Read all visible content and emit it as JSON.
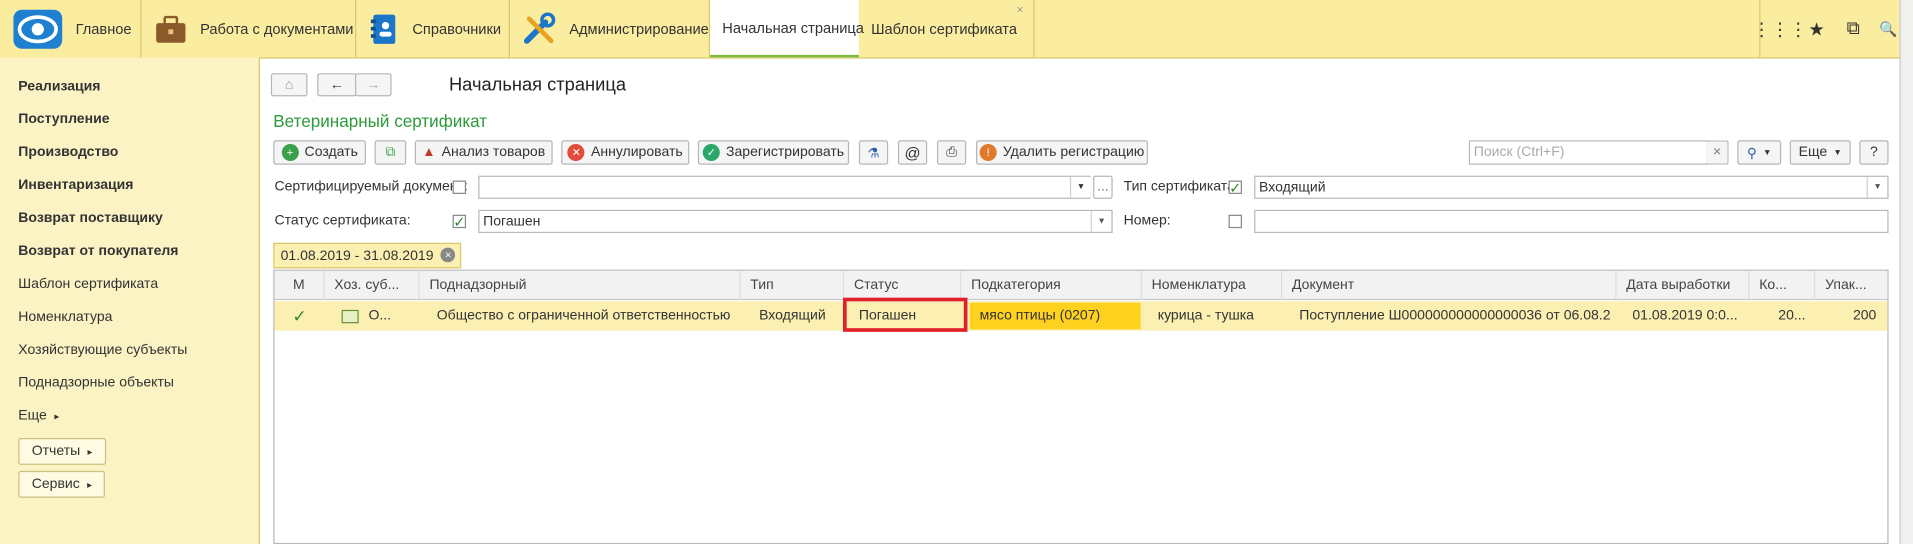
{
  "colors": {
    "topbar_bg": "#fbeda0",
    "sidebar_bg": "#fbf3c4",
    "accent_green": "#7dbb3e",
    "selected_row": "#fbf0b2",
    "highlight_cell": "#ffd21f",
    "status_highlight_border": "#e0202a"
  },
  "topbar": {
    "sections": [
      {
        "label": "Главное",
        "icon": "app-logo-icon"
      },
      {
        "label": "Работа с документами",
        "icon": "briefcase-icon"
      },
      {
        "label": "Справочники",
        "icon": "address-book-icon"
      },
      {
        "label": "Администрирование",
        "icon": "tools-icon"
      }
    ],
    "tabs": [
      {
        "label": "Начальная страница",
        "active": true
      },
      {
        "label": "Шаблон сертификата",
        "active": false,
        "close": "×"
      }
    ],
    "right_icons": [
      "apps-grid-icon",
      "star-icon",
      "history-icon",
      "search-icon"
    ],
    "right_glyphs": [
      "⋮⋮⋮",
      "★",
      "⧉",
      "🔍"
    ]
  },
  "sidebar": {
    "items": [
      {
        "label": "Реализация",
        "bold": true
      },
      {
        "label": "Поступление",
        "bold": true
      },
      {
        "label": "Производство",
        "bold": true
      },
      {
        "label": "Инвентаризация",
        "bold": true
      },
      {
        "label": "Возврат поставщику",
        "bold": true
      },
      {
        "label": "Возврат от покупателя",
        "bold": true
      },
      {
        "label": "Шаблон сертификата",
        "bold": false
      },
      {
        "label": "Номенклатура",
        "bold": false
      },
      {
        "label": "Хозяйствующие субъекты",
        "bold": false
      },
      {
        "label": "Поднадзорные объекты",
        "bold": false
      }
    ],
    "more_label": "Еще",
    "reports_button": "Отчеты",
    "service_button": "Сервис"
  },
  "page": {
    "title": "Начальная страница",
    "form_title": "Ветеринарный сертификат"
  },
  "toolbar": {
    "create": "Создать",
    "analyze": "Анализ товаров",
    "annul": "Аннулировать",
    "register": "Зарегистрировать",
    "at_symbol": "@",
    "unregister": "Удалить регистрацию",
    "search_placeholder": "Поиск (Ctrl+F)",
    "more": "Еще",
    "help": "?"
  },
  "filters": {
    "cert_doc_label": "Сертифицируемый документ:",
    "cert_doc_checked": false,
    "cert_doc_value": "",
    "cert_type_label": "Тип сертификата:",
    "cert_type_checked": true,
    "cert_type_value": "Входящий",
    "status_label": "Статус сертификата:",
    "status_checked": true,
    "status_value": "Погашен",
    "number_label": "Номер:",
    "number_checked": false,
    "number_value": "",
    "period": "01.08.2019 - 31.08.2019"
  },
  "grid": {
    "columns": [
      "М",
      "Хоз. суб...",
      "Поднадзорный",
      "Тип",
      "Статус",
      "Подкатегория",
      "Номенклатура",
      "Документ",
      "Дата выработки",
      "Ко...",
      "Упак..."
    ],
    "rows": [
      {
        "mark": "✓",
        "entity": "О...",
        "supervised": "Общество с ограниченной ответственностью ...",
        "type": "Входящий",
        "status": "Погашен",
        "subcategory": "мясо птицы (0207)",
        "nomenclature": "курица - тушка",
        "document": "Поступление Ш000000000000000036 от 06.08.2...",
        "production_date": "01.08.2019 0:0...",
        "quantity": "20...",
        "package": "200"
      }
    ]
  }
}
